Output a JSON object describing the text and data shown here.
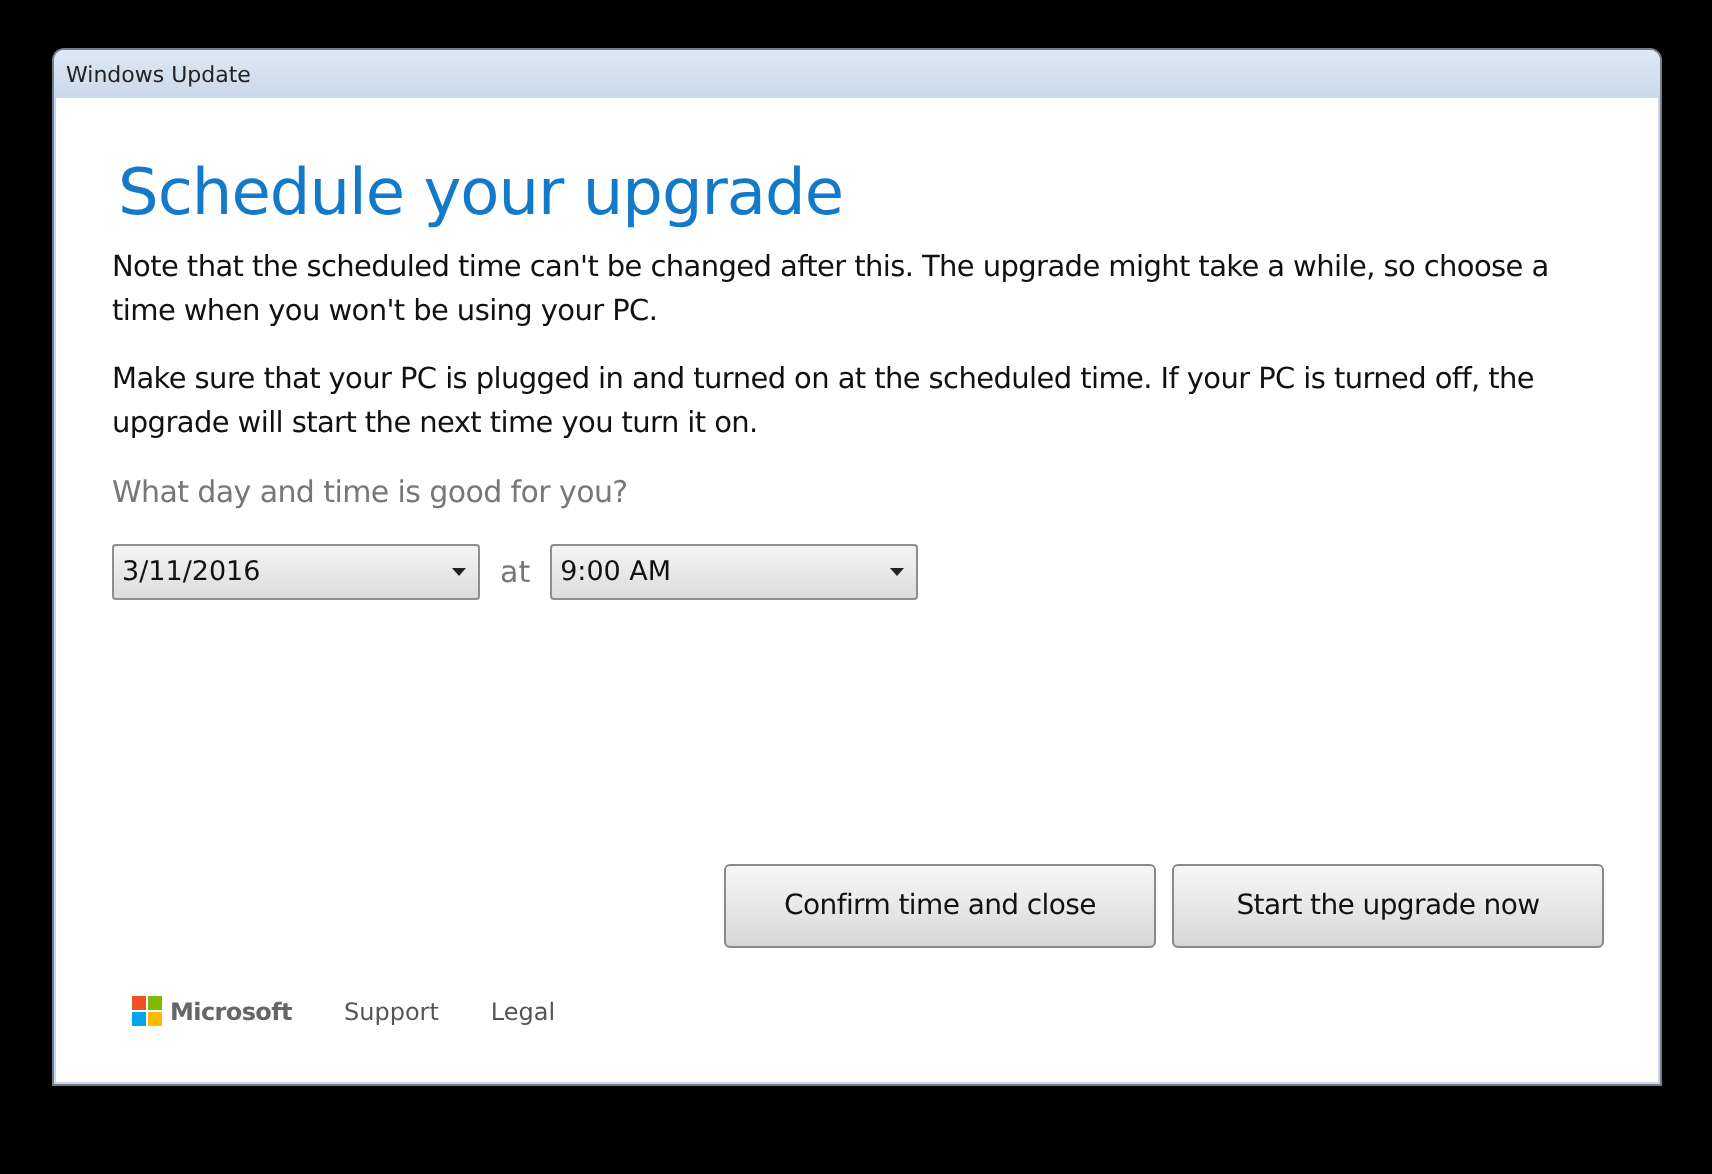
{
  "window": {
    "title": "Windows Update"
  },
  "heading": "Schedule your upgrade",
  "paragraphs": [
    "Note that the scheduled time can't be changed after this. The upgrade might take a while, so choose a time when you won't be using your PC.",
    "Make sure that your PC is plugged in and turned on at the scheduled time. If your PC is turned off, the upgrade will start the next time you turn it on."
  ],
  "question": "What day and time is good for you?",
  "date_dropdown": {
    "value": "3/11/2016"
  },
  "at_label": "at",
  "time_dropdown": {
    "value": "9:00 AM"
  },
  "buttons": [
    "Confirm time and close",
    "Start the upgrade now"
  ],
  "footer": {
    "brand": "Microsoft",
    "links": [
      "Support",
      "Legal"
    ]
  }
}
